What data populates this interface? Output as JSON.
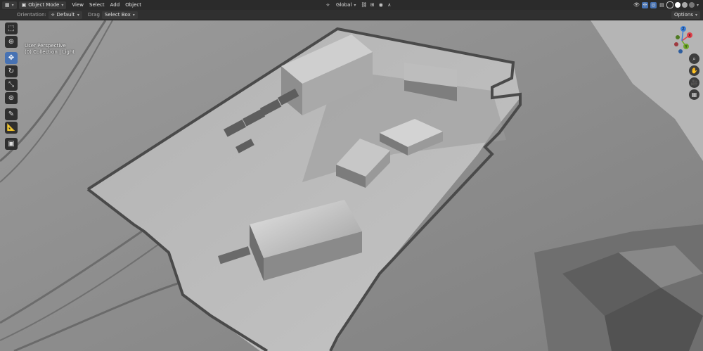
{
  "header": {
    "mode_label": "Object Mode",
    "menus": [
      "View",
      "Select",
      "Add",
      "Object"
    ],
    "transform_orientation": "Global"
  },
  "toolsettings": {
    "orientation_label": "Orientation:",
    "orientation_value": "Default",
    "drag_label": "Drag",
    "drag_value": "Select Box",
    "options_label": "Options"
  },
  "viewport": {
    "perspective": "User Perspective",
    "collection": "(0) Collection | Light"
  },
  "gizmo": {
    "axis_x": "X",
    "axis_y": "Y",
    "axis_z": "Z"
  },
  "icons": {
    "editor_type": "grid-icon",
    "tools": [
      "select-box-icon",
      "cursor-icon",
      "move-icon",
      "rotate-icon",
      "scale-icon",
      "transform-icon",
      "annotate-icon",
      "measure-icon",
      "add-cube-icon"
    ],
    "nav": [
      "zoom-icon",
      "hand-pan-icon",
      "camera-icon",
      "grid-view-icon"
    ]
  },
  "colors": {
    "active_tool": "#4772b3",
    "header_bg": "#2b2b2b",
    "axis_x": "#e0404a",
    "axis_y": "#6fa82a",
    "axis_z": "#3d7fd8"
  }
}
